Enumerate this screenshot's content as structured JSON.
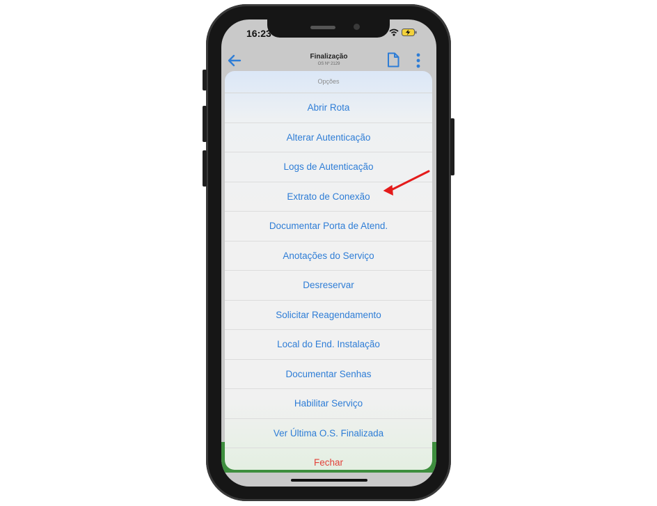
{
  "status_bar": {
    "time": "16:23"
  },
  "app_bar": {
    "title": "Finalização",
    "subtitle": "OS Nº 2129"
  },
  "options_sheet": {
    "title": "Opções",
    "items": [
      "Abrir Rota",
      "Alterar Autenticação",
      "Logs de Autenticação",
      "Extrato de Conexão",
      "Documentar Porta de Atend.",
      "Anotações do Serviço",
      "Desreservar",
      "Solicitar Reagendamento",
      "Local do End. Instalação",
      "Documentar Senhas",
      "Habilitar Serviço",
      "Ver Última O.S. Finalizada"
    ],
    "cancel_label": "Fechar"
  },
  "colors": {
    "accent": "#2e7dd6",
    "destructive": "#e2423a",
    "annotation": "#e41b1b"
  }
}
